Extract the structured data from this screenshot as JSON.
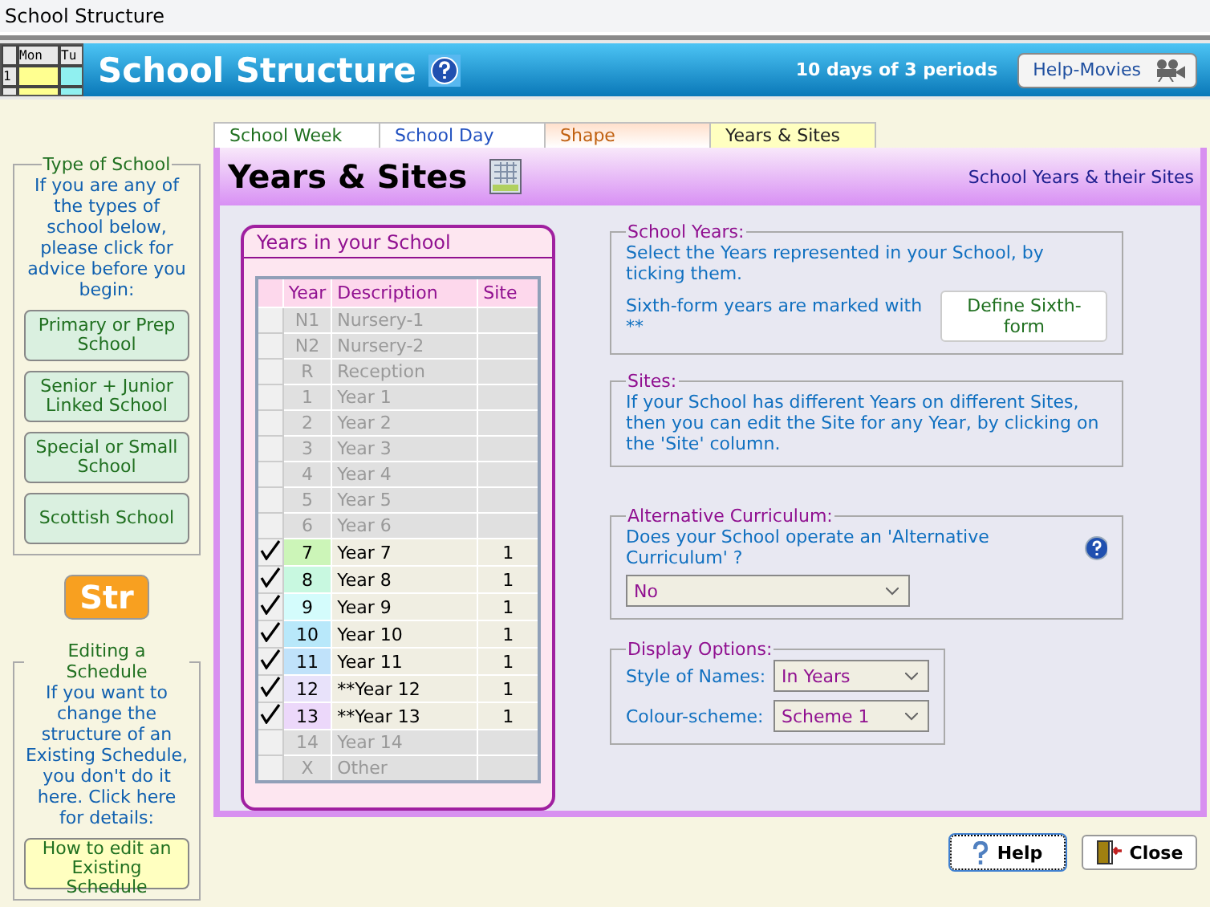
{
  "window": {
    "title": "School Structure"
  },
  "header": {
    "logo_labels": [
      "Mon",
      "Tu",
      "1"
    ],
    "title": "School Structure",
    "summary": "10 days of 3 periods",
    "movies_button": "Help-Movies"
  },
  "sidebar": {
    "type_group": {
      "title": "Type of School",
      "text": "If you are any of the types of school below, please click for advice before you begin:",
      "buttons": [
        "Primary or Prep School",
        "Senior + Junior Linked School",
        "Special or Small School",
        "Scottish School"
      ]
    },
    "logo_button": "Str",
    "edit_group": {
      "title": "Editing a Schedule",
      "text": "If you want to change the structure of an Existing Schedule, you don't do it here. Click here for details:",
      "button": "How to edit an Existing Schedule"
    }
  },
  "tabs": [
    {
      "label": "School Week",
      "selected": false,
      "color": "#207020"
    },
    {
      "label": "School Day",
      "selected": false,
      "color": "#2050c0"
    },
    {
      "label": "Shape",
      "selected": false,
      "color": "#c06010"
    },
    {
      "label": "Years & Sites",
      "selected": true,
      "color": "#202020"
    }
  ],
  "page": {
    "title": "Years & Sites",
    "subtitle": "School Years & their Sites"
  },
  "years": {
    "title": "Years in your School",
    "columns": [
      "Year",
      "Description",
      "Site"
    ],
    "rows": [
      {
        "year": "N1",
        "description": "Nursery-1",
        "checked": false
      },
      {
        "year": "N2",
        "description": "Nursery-2",
        "checked": false
      },
      {
        "year": "R",
        "description": "Reception",
        "checked": false
      },
      {
        "year": "1",
        "description": "Year 1",
        "checked": false
      },
      {
        "year": "2",
        "description": "Year 2",
        "checked": false
      },
      {
        "year": "3",
        "description": "Year 3",
        "checked": false
      },
      {
        "year": "4",
        "description": "Year 4",
        "checked": false
      },
      {
        "year": "5",
        "description": "Year 5",
        "checked": false
      },
      {
        "year": "6",
        "description": "Year 6",
        "checked": false
      },
      {
        "year": "7",
        "description": "Year 7",
        "site": "1",
        "checked": true,
        "color": "#ccf5b8"
      },
      {
        "year": "8",
        "description": "Year 8",
        "site": "1",
        "checked": true,
        "color": "#c8f8e0"
      },
      {
        "year": "9",
        "description": "Year 9",
        "site": "1",
        "checked": true,
        "color": "#d4fcfc"
      },
      {
        "year": "10",
        "description": "Year 10",
        "site": "1",
        "checked": true,
        "color": "#b8e8fa"
      },
      {
        "year": "11",
        "description": "Year 11",
        "site": "1",
        "checked": true,
        "color": "#c0e2fa"
      },
      {
        "year": "12",
        "description": "**Year 12",
        "site": "1",
        "checked": true,
        "color": "#e8e2fa"
      },
      {
        "year": "13",
        "description": "**Year 13",
        "site": "1",
        "checked": true,
        "color": "#ecd8fa"
      },
      {
        "year": "14",
        "description": "Year 14",
        "checked": false
      },
      {
        "year": "X",
        "description": "Other",
        "checked": false
      }
    ]
  },
  "school_years": {
    "title": "School Years:",
    "text": "Select the Years represented in your School, by ticking them.",
    "note": "Sixth-form years are marked with **",
    "button": "Define Sixth-form"
  },
  "sites": {
    "title": "Sites:",
    "text": "If your School has different Years on different Sites, then you can edit the Site for any Year, by clicking on the 'Site' column."
  },
  "curriculum": {
    "title": "Alternative Curriculum:",
    "question": "Does your School operate an 'Alternative Curriculum' ?",
    "value": "No"
  },
  "display": {
    "title": "Display Options:",
    "fields": [
      {
        "label": "Style of Names:",
        "value": "In Years"
      },
      {
        "label": "Colour-scheme:",
        "value": "Scheme 1"
      }
    ]
  },
  "footer": {
    "help_button": "Help",
    "close_button": "Close"
  }
}
